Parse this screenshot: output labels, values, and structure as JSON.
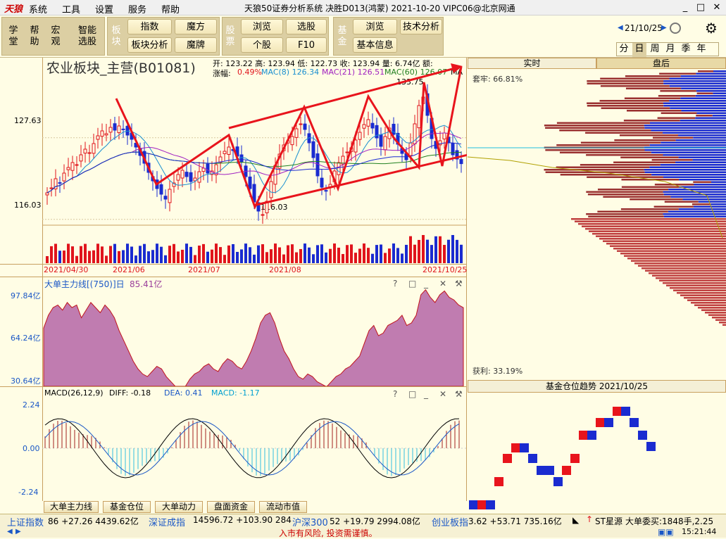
{
  "app": {
    "logo": "天狼",
    "menus": [
      "系统",
      "工具",
      "设置",
      "服务",
      "帮助"
    ],
    "title": "天狼50证券分析系统  决胜D013(鸿蒙)  2021-10-20 VIPC06@北京网通",
    "win_buttons": [
      "_",
      "□",
      "✕"
    ]
  },
  "toolbar": {
    "left_buttons": [
      "学堂",
      "帮助",
      "宏观",
      "智能选股"
    ],
    "group_bankuai": {
      "label": "板块",
      "buttons": [
        "指数",
        "魔方",
        "板块分析",
        "魔牌"
      ]
    },
    "group_gupiao": {
      "label": "股票",
      "buttons": [
        "浏览",
        "选股",
        "个股",
        "F10"
      ]
    },
    "group_jijin": {
      "label": "基金",
      "buttons": [
        "浏览",
        "技术分析",
        "基本信息"
      ]
    },
    "date": "21/10/25",
    "periods": [
      "分",
      "日",
      "周",
      "月",
      "季",
      "年"
    ],
    "active_period": "日"
  },
  "main_chart": {
    "title": "农业板块_主营(B01081)",
    "info_line1": "开: 123.22 高: 123.94 低: 122.73 收: 123.94 量: 6.74亿 额:",
    "info_zf_label": "涨幅:",
    "info_zf_value": "0.49%",
    "ma8": "MAC(8) 126.34",
    "ma21": "MAC(21) 126.51",
    "ma60": "MAC(60) 126.07",
    "ma_more": "MA",
    "y_high": "127.63",
    "y_low": "116.03",
    "peak_label": "133.75",
    "low_label": "116.03",
    "dates": [
      "2021/04/30",
      "2021/06",
      "2021/07",
      "2021/08",
      "2021/10/25"
    ]
  },
  "right_panel": {
    "tabs": [
      "实时",
      "盘后"
    ],
    "taolao": "套牢: 66.81%",
    "huoli": "获利: 33.19%",
    "fund_title": "基金仓位趋势 2021/10/25"
  },
  "panel_dadan": {
    "title": "大单主力线[(750)]日",
    "value": "85.41亿",
    "ticks": [
      "97.84亿",
      "64.24亿",
      "30.64亿"
    ]
  },
  "panel_macd": {
    "title": "MACD(26,12,9)",
    "diff": "DIFF: -0.18",
    "dea": "DEA: 0.41",
    "macd": "MACD: -1.17",
    "ticks": [
      "2.24",
      "0.00",
      "-2.24"
    ]
  },
  "bottom_tabs": [
    "大单主力线",
    "基金仓位",
    "大单动力",
    "盘面资金",
    "流动市值"
  ],
  "tickers": [
    {
      "name": "上证指数",
      "values": "86  +27.26  4439.62亿"
    },
    {
      "name": "深证成指",
      "values": "14596.72  +103.90  284"
    },
    {
      "name": "沪深300",
      "values": "52  +19.79  2994.08亿"
    },
    {
      "name": "创业板指",
      "values": "3.62  +53.71  735.16亿"
    }
  ],
  "status": {
    "st": "ST星源",
    "dadan": "大单委买:1848手,2.25",
    "time": "15:21:44",
    "risk": "入市有风险, 投资需谨慎。"
  },
  "colors": {
    "up": "#e0141c",
    "down": "#1a2bd0",
    "hist": "#9b4fa0",
    "arrow": "#e8141c"
  },
  "chart_data": {
    "type": "candlestick",
    "close_series": [
      119.8,
      120.5,
      121.8,
      121.2,
      122.6,
      123.4,
      124.1,
      123.8,
      125.2,
      126.0,
      125.5,
      126.8,
      127.9,
      128.6,
      128.2,
      129.1,
      128.7,
      129.3,
      128.8,
      128.0,
      127.4,
      126.3,
      125.1,
      124.0,
      122.7,
      121.5,
      120.4,
      119.6,
      118.9,
      120.3,
      121.2,
      122.4,
      123.0,
      122.1,
      121.4,
      121.9,
      122.8,
      123.3,
      122.6,
      122.9,
      123.8,
      124.9,
      125.7,
      126.3,
      125.8,
      125.0,
      124.2,
      122.1,
      120.4,
      118.5,
      117.2,
      116.7,
      118.6,
      121.4,
      123.7,
      125.3,
      126.6,
      127.2,
      127.8,
      128.9,
      129.6,
      128.8,
      126.9,
      124.8,
      122.2,
      120.6,
      120.1,
      121.0,
      122.9,
      124.1,
      125.0,
      125.6,
      126.2,
      127.3,
      128.4,
      129.5,
      130.2,
      129.0,
      127.6,
      126.4,
      127.8,
      129.0,
      128.1,
      126.7,
      125.4,
      124.5,
      126.9,
      129.6,
      132.2,
      133.4,
      130.8,
      127.5,
      126.1,
      127.2,
      128.3,
      126.9,
      125.2,
      124.6,
      123.94
    ]
  }
}
